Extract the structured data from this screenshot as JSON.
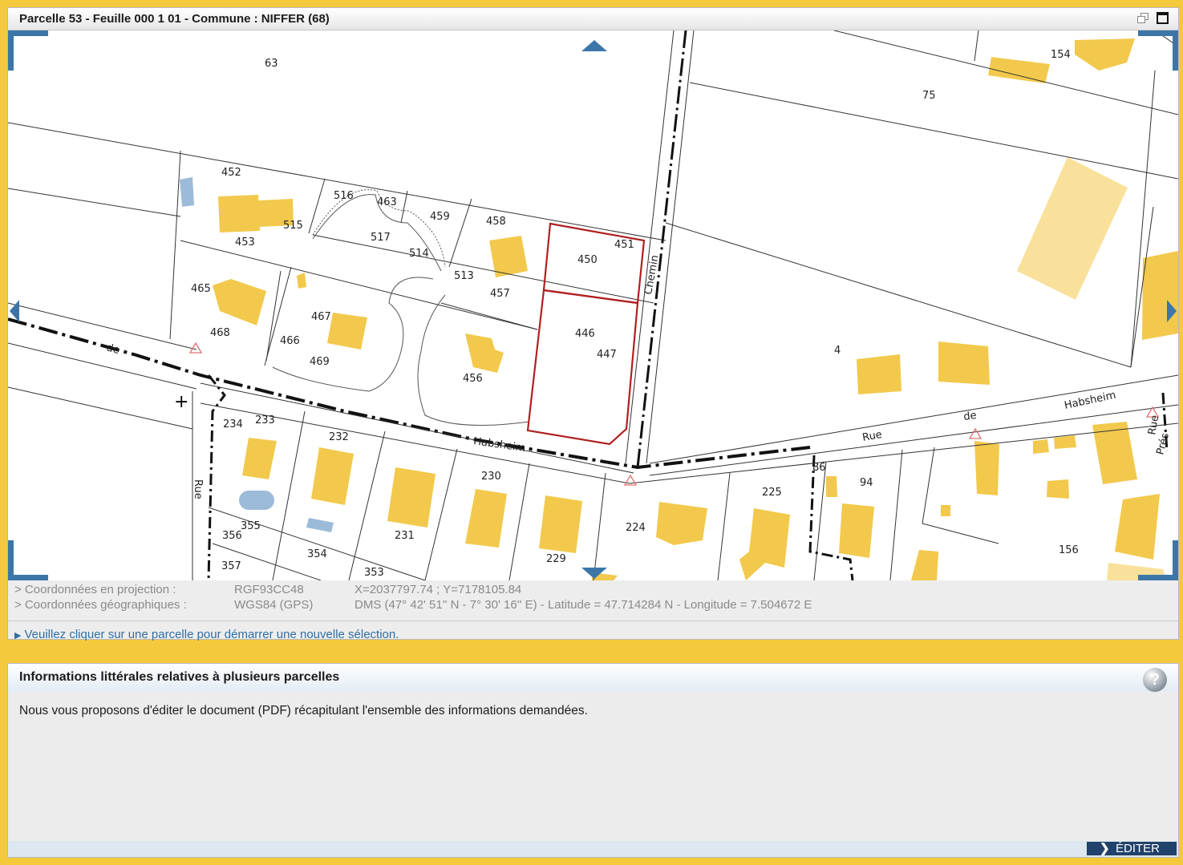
{
  "window": {
    "title": "Parcelle 53 - Feuille 000 1 01 - Commune : NIFFER (68)"
  },
  "map": {
    "parcel_labels": [
      "63",
      "75",
      "154",
      "452",
      "516",
      "463",
      "459",
      "458",
      "451",
      "450",
      "515",
      "517",
      "453",
      "514",
      "513",
      "457",
      "465",
      "467",
      "446",
      "447",
      "4",
      "468",
      "466",
      "469",
      "456",
      "234",
      "233",
      "232",
      "230",
      "225",
      "94",
      "156",
      "224",
      "86",
      "231",
      "355",
      "356",
      "354",
      "229",
      "357",
      "353"
    ],
    "street_labels": [
      "Chemin",
      "Rue",
      "de",
      "Habsheim",
      "Rue",
      "Habsheim",
      "de",
      "Rue",
      "Prés"
    ]
  },
  "coords": {
    "projection": {
      "label": "> Coordonnées en projection :",
      "system": "RGF93CC48",
      "value": "X=2037797.74 ; Y=7178105.84"
    },
    "geographic": {
      "label": "> Coordonnées géographiques :",
      "system": "WGS84 (GPS)",
      "value": "DMS (47° 42' 51'' N - 7° 30' 16'' E) - Latitude = 47.714284 N - Longitude = 7.504672 E"
    },
    "hint": "Veuillez cliquer sur une parcelle pour démarrer une nouvelle sélection."
  },
  "info_panel": {
    "title": "Informations littérales relatives à plusieurs parcelles",
    "text": "Nous vous proposons d'éditer le document (PDF) récapitulant l'ensemble des informations demandées.",
    "edit_label": "ÉDITER",
    "help_symbol": "?"
  },
  "colors": {
    "background": "#f5c93c",
    "building": "#f2c94c",
    "selection": "#b02020",
    "nav": "#3c76a8"
  }
}
